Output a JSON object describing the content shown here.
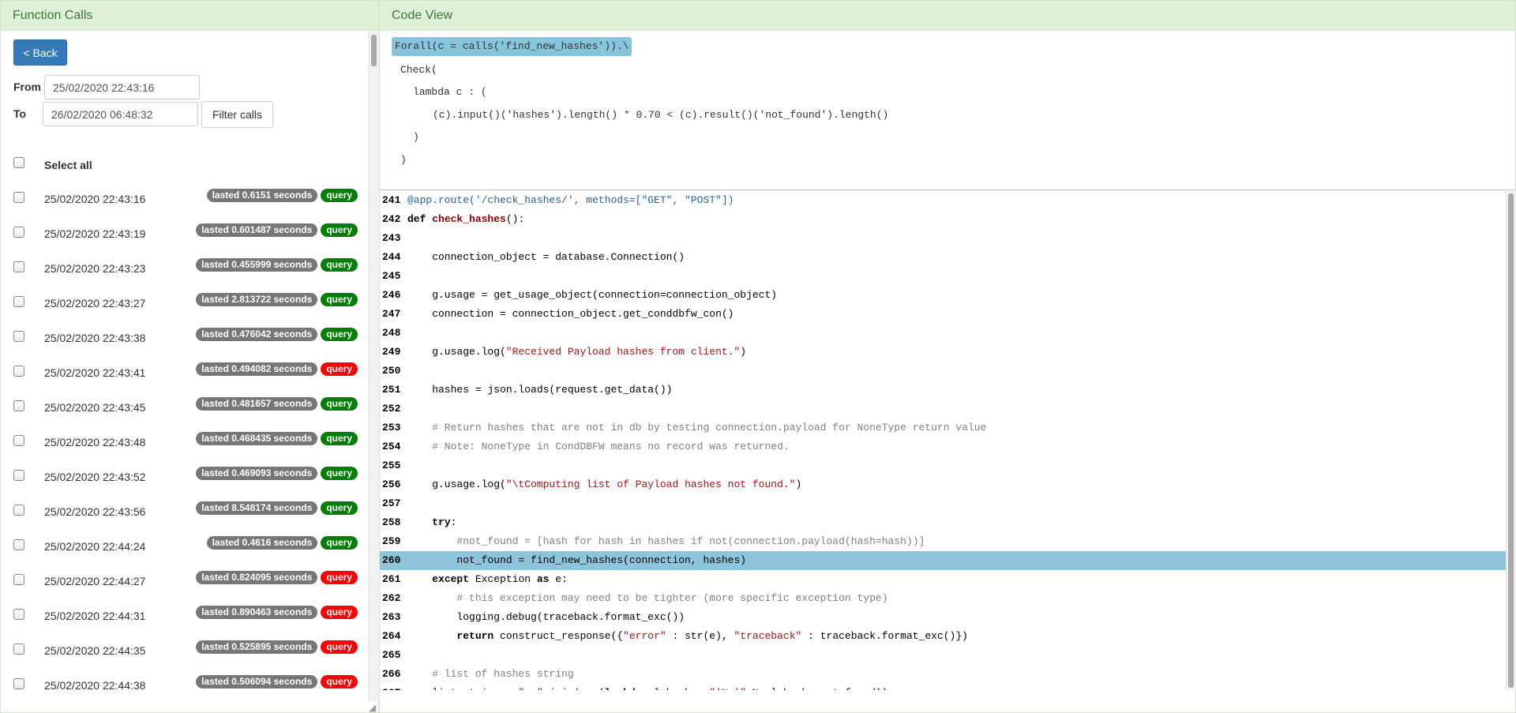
{
  "left_panel": {
    "title": "Function Calls",
    "back_label": "< Back",
    "from_label": "From",
    "from_value": "25/02/2020 22:43:16",
    "to_label": "To",
    "to_value": "26/02/2020 06:48:32",
    "filter_label": "Filter calls",
    "select_all_label": "Select all",
    "calls": [
      {
        "date": "25/02/2020 22:43:16",
        "duration": "lasted 0.6151 seconds",
        "tag": "query",
        "status": "pass"
      },
      {
        "date": "25/02/2020 22:43:19",
        "duration": "lasted 0.601487 seconds",
        "tag": "query",
        "status": "pass"
      },
      {
        "date": "25/02/2020 22:43:23",
        "duration": "lasted 0.455999 seconds",
        "tag": "query",
        "status": "pass"
      },
      {
        "date": "25/02/2020 22:43:27",
        "duration": "lasted 2.813722 seconds",
        "tag": "query",
        "status": "pass"
      },
      {
        "date": "25/02/2020 22:43:38",
        "duration": "lasted 0.476042 seconds",
        "tag": "query",
        "status": "pass"
      },
      {
        "date": "25/02/2020 22:43:41",
        "duration": "lasted 0.494082 seconds",
        "tag": "query",
        "status": "fail"
      },
      {
        "date": "25/02/2020 22:43:45",
        "duration": "lasted 0.481657 seconds",
        "tag": "query",
        "status": "pass"
      },
      {
        "date": "25/02/2020 22:43:48",
        "duration": "lasted 0.468435 seconds",
        "tag": "query",
        "status": "pass"
      },
      {
        "date": "25/02/2020 22:43:52",
        "duration": "lasted 0.469093 seconds",
        "tag": "query",
        "status": "pass"
      },
      {
        "date": "25/02/2020 22:43:56",
        "duration": "lasted 8.548174 seconds",
        "tag": "query",
        "status": "pass"
      },
      {
        "date": "25/02/2020 22:44:24",
        "duration": "lasted 0.4616 seconds",
        "tag": "query",
        "status": "pass"
      },
      {
        "date": "25/02/2020 22:44:27",
        "duration": "lasted 0.824095 seconds",
        "tag": "query",
        "status": "fail"
      },
      {
        "date": "25/02/2020 22:44:31",
        "duration": "lasted 0.890463 seconds",
        "tag": "query",
        "status": "fail"
      },
      {
        "date": "25/02/2020 22:44:35",
        "duration": "lasted 0.525895 seconds",
        "tag": "query",
        "status": "fail"
      },
      {
        "date": "25/02/2020 22:44:38",
        "duration": "lasted 0.506094 seconds",
        "tag": "query",
        "status": "fail"
      }
    ]
  },
  "right_panel": {
    "title": "Code View",
    "formula": {
      "highlight": "Forall(c = calls('find_new_hashes')).\\",
      "lines": [
        "Check(",
        "lambda c : (",
        "(c).input()('hashes').length() * 0.70 < (c).result()('not_found').length()",
        ")",
        ")"
      ]
    },
    "highlighted_line": 260,
    "code": [
      {
        "n": 241,
        "t": [
          [
            "deco",
            "@app.route('/check_hashes/', methods=[\"GET\", \"POST\"])"
          ]
        ]
      },
      {
        "n": 242,
        "t": [
          [
            "kw",
            "def "
          ],
          [
            "fn",
            "check_hashes"
          ],
          [
            "",
            "():"
          ]
        ]
      },
      {
        "n": 243,
        "t": []
      },
      {
        "n": 244,
        "t": [
          [
            "",
            "    connection_object = database.Connection()"
          ]
        ]
      },
      {
        "n": 245,
        "t": []
      },
      {
        "n": 246,
        "t": [
          [
            "",
            "    g.usage = get_usage_object(connection=connection_object)"
          ]
        ]
      },
      {
        "n": 247,
        "t": [
          [
            "",
            "    connection = connection_object.get_conddbfw_con()"
          ]
        ]
      },
      {
        "n": 248,
        "t": []
      },
      {
        "n": 249,
        "t": [
          [
            "",
            "    g.usage.log("
          ],
          [
            "str",
            "\"Received Payload hashes from client.\""
          ],
          [
            "",
            ")"
          ]
        ]
      },
      {
        "n": 250,
        "t": []
      },
      {
        "n": 251,
        "t": [
          [
            "",
            "    hashes = json.loads(request.get_data())"
          ]
        ]
      },
      {
        "n": 252,
        "t": []
      },
      {
        "n": 253,
        "t": [
          [
            "cm",
            "    # Return hashes that are not in db by testing connection.payload for NoneType return value"
          ]
        ]
      },
      {
        "n": 254,
        "t": [
          [
            "cm",
            "    # Note: NoneType in CondDBFW means no record was returned."
          ]
        ]
      },
      {
        "n": 255,
        "t": []
      },
      {
        "n": 256,
        "t": [
          [
            "",
            "    g.usage.log("
          ],
          [
            "str",
            "\"\\tComputing list of Payload hashes not found.\""
          ],
          [
            "",
            ")"
          ]
        ]
      },
      {
        "n": 257,
        "t": []
      },
      {
        "n": 258,
        "t": [
          [
            "",
            "    "
          ],
          [
            "kw",
            "try"
          ],
          [
            "",
            ":"
          ]
        ]
      },
      {
        "n": 259,
        "t": [
          [
            "cm",
            "        #not_found = [hash for hash in hashes if not(connection.payload(hash=hash))]"
          ]
        ]
      },
      {
        "n": 260,
        "t": [
          [
            "",
            "        not_found = find_new_hashes(connection, hashes)"
          ]
        ]
      },
      {
        "n": 261,
        "t": [
          [
            "",
            "    "
          ],
          [
            "kw",
            "except"
          ],
          [
            "",
            " Exception "
          ],
          [
            "kw",
            "as"
          ],
          [
            "",
            " e:"
          ]
        ]
      },
      {
        "n": 262,
        "t": [
          [
            "cm",
            "        # this exception may need to be tighter (more specific exception type)"
          ]
        ]
      },
      {
        "n": 263,
        "t": [
          [
            "",
            "        logging.debug(traceback.format_exc())"
          ]
        ]
      },
      {
        "n": 264,
        "t": [
          [
            "",
            "        "
          ],
          [
            "kw",
            "return"
          ],
          [
            "",
            " construct_response({"
          ],
          [
            "str",
            "\"error\""
          ],
          [
            "",
            " : str(e), "
          ],
          [
            "str",
            "\"traceback\""
          ],
          [
            "",
            " : traceback.format_exc()})"
          ]
        ]
      },
      {
        "n": 265,
        "t": []
      },
      {
        "n": 266,
        "t": [
          [
            "cm",
            "    # list of hashes string"
          ]
        ]
      },
      {
        "n": 267,
        "t": [
          [
            "",
            "    list_string = "
          ],
          [
            "str",
            "\", \""
          ],
          [
            "",
            ".join(map("
          ],
          [
            "kw",
            "lambda"
          ],
          [
            "",
            " pl_hash : "
          ],
          [
            "str",
            "\"'%s'\""
          ],
          [
            "",
            " % pl_hash, not_found))"
          ]
        ]
      }
    ]
  },
  "colors": {
    "heading_bg": "#dff0d8",
    "heading_text": "#3c763d",
    "primary_button": "#337ab7",
    "badge_grey": "#777777",
    "badge_pass": "#008000",
    "badge_fail": "#ff0000",
    "highlight_blue": "#8ec4dc"
  }
}
